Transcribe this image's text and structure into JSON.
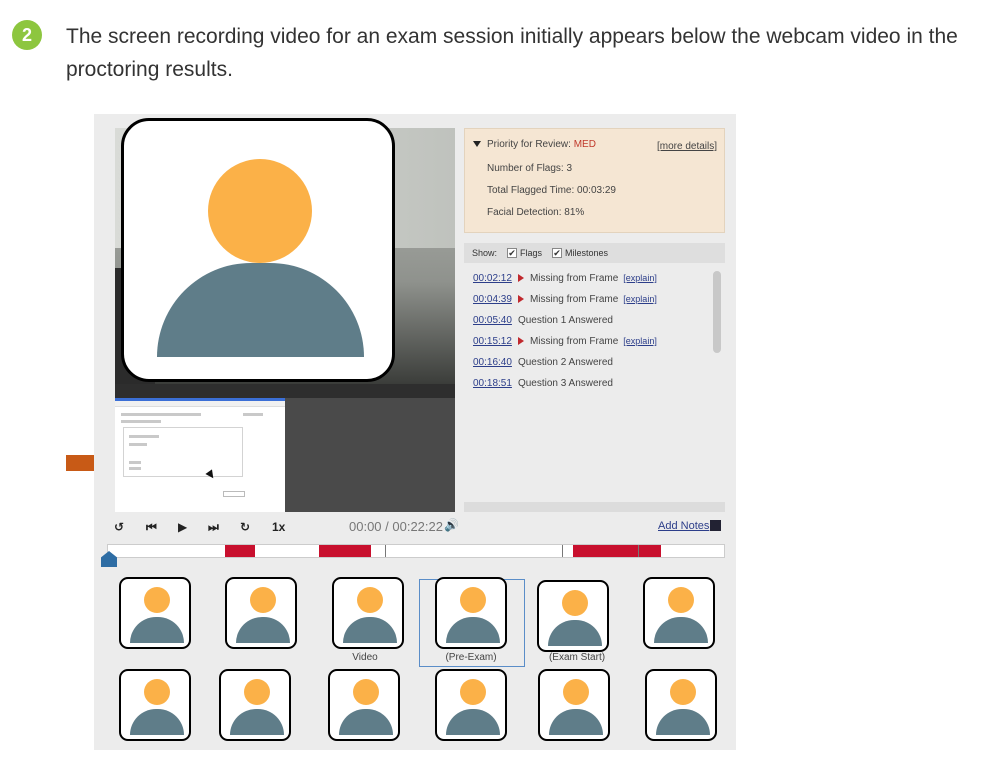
{
  "step": {
    "number": "2",
    "text": "The screen recording video for an exam session initially appears below the webcam video in the proctoring results."
  },
  "priority": {
    "label": "Priority for Review:",
    "level": "MED",
    "more_details": "[more details]",
    "flags": "Number of Flags: 3",
    "flagged_time": "Total Flagged Time: 00:03:29",
    "facial": "Facial Detection: 81%"
  },
  "show": {
    "label": "Show:",
    "flags": "Flags",
    "milestones": "Milestones",
    "check": "✔"
  },
  "events": [
    {
      "time": "00:02:12",
      "text": "Missing from Frame",
      "explain": "[explain]",
      "flag": true
    },
    {
      "time": "00:04:39",
      "text": "Missing from Frame",
      "explain": "[explain]",
      "flag": true
    },
    {
      "time": "00:05:40",
      "text": "Question 1 Answered",
      "explain": "",
      "flag": false
    },
    {
      "time": "00:15:12",
      "text": "Missing from Frame",
      "explain": "[explain]",
      "flag": true
    },
    {
      "time": "00:16:40",
      "text": "Question 2 Answered",
      "explain": "",
      "flag": false
    },
    {
      "time": "00:18:51",
      "text": "Question 3 Answered",
      "explain": "",
      "flag": false
    }
  ],
  "controls": {
    "rewind": "↺",
    "prev": "⏮",
    "play": "▶",
    "next": "⏭",
    "forward": "↻",
    "speed": "1x",
    "time": "00:00 / 00:22:22",
    "volume": "🔊",
    "add_notes": "Add Notes"
  },
  "thumb_captions": {
    "video": "Video",
    "pre_exam": "(Pre-Exam)",
    "exam_start": "(Exam Start)"
  },
  "colors": {
    "flag": "#c8102e",
    "priority_bg": "#f5e6d3",
    "accent": "#2e6da4",
    "arrow": "#c85a16"
  }
}
